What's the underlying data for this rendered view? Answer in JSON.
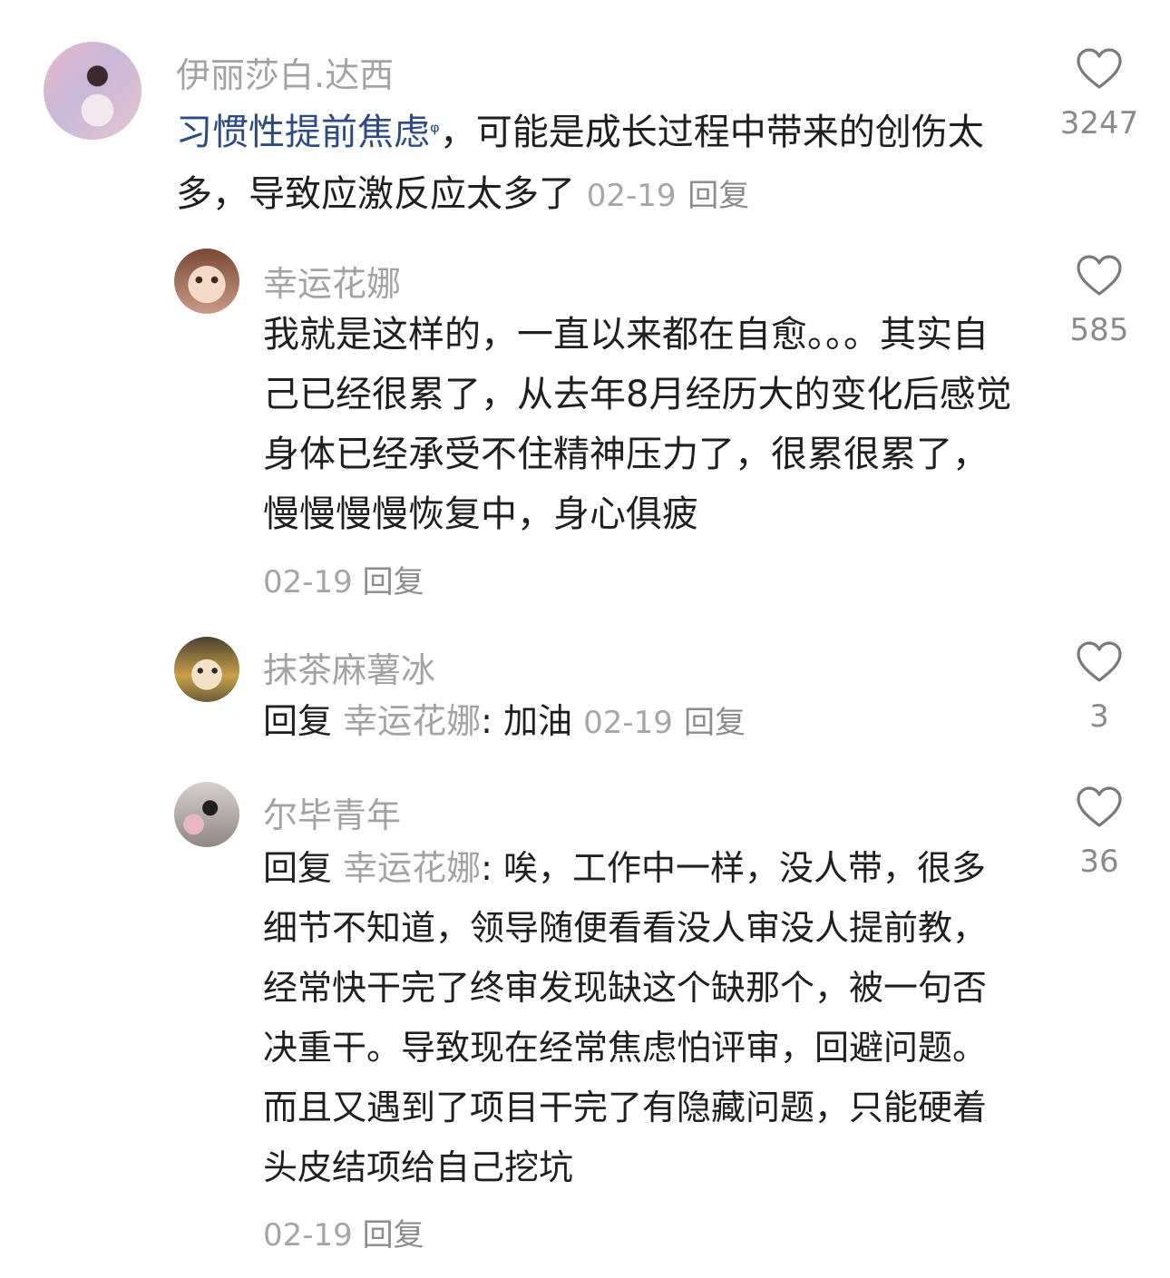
{
  "comments": [
    {
      "username": "伊丽莎白.达西",
      "text_link": "习惯性提前焦虑",
      "search_mark": "ᵠ",
      "text": "，可能是成长过程中带来的创伤太多，导致应激反应太多了",
      "date": "02-19",
      "reply": "回复",
      "likes": "3247"
    },
    {
      "username": "幸运花娜",
      "text": "我就是这样的，一直以来都在自愈。。。其实自己已经很累了，从去年8月经历大的变化后感觉身体已经承受不住精神压力了，很累很累了，慢慢慢慢恢复中，身心俱疲",
      "date": "02-19",
      "reply": "回复",
      "likes": "585"
    },
    {
      "username": "抹茶麻薯冰",
      "reply_prefix": "回复",
      "reply_to": "幸运花娜",
      "text": ": 加油",
      "date": "02-19",
      "reply": "回复",
      "likes": "3"
    },
    {
      "username": "尔毕青年",
      "reply_prefix": "回复",
      "reply_to": "幸运花娜",
      "text": ": 唉，工作中一样，没人带，很多细节不知道，领导随便看看没人审没人提前教，经常快干完了终审发现缺这个缺那个，被一句否决重干。导致现在经常焦虑怕评审，回避问题。而且又遇到了项目干完了有隐藏问题，只能硬着头皮结项给自己挖坑",
      "date": "02-19",
      "reply": "回复",
      "likes": "36"
    }
  ]
}
